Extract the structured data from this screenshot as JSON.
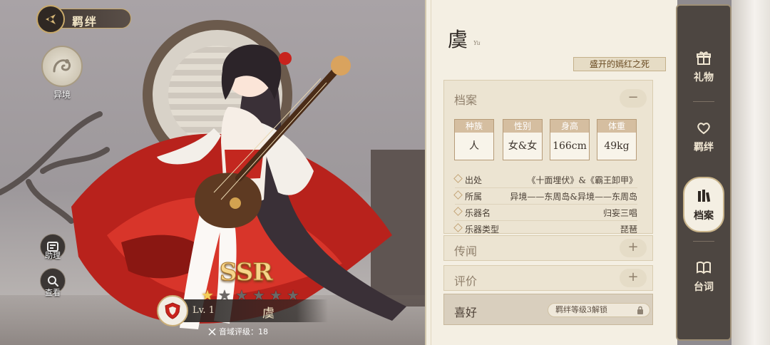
{
  "header": {
    "title": "羁绊"
  },
  "left_menu": {
    "world_label": "异境",
    "assist_label": "助理",
    "view_label": "查看"
  },
  "character": {
    "rarity": "SSR",
    "stars_total": 6,
    "stars_filled": 1,
    "level": "Lv. 1",
    "name": "虞",
    "rank": "音域评级：18"
  },
  "profile": {
    "name": "虞",
    "name_romaji": "Yu",
    "epithet": "盛开的嫣红之死",
    "section_archive": "档案",
    "attributes": [
      {
        "label": "种族",
        "value": "人"
      },
      {
        "label": "性别",
        "value": "女&女"
      },
      {
        "label": "身高",
        "value": "166cm"
      },
      {
        "label": "体重",
        "value": "49kg"
      }
    ],
    "info": [
      {
        "key": "出处",
        "value": "《十面埋伏》&《霸王卸甲》"
      },
      {
        "key": "所属",
        "value": "异境——东周岛&异境——东周岛"
      },
      {
        "key": "乐器名",
        "value": "归妄三唱"
      },
      {
        "key": "乐器类型",
        "value": "琵琶"
      }
    ],
    "section_rumor": "传闻",
    "section_review": "评价",
    "section_favorite": "喜好",
    "favorite_lock": "羁绊等级3解锁",
    "toggle_minus": "−",
    "toggle_plus": "+"
  },
  "tabs": [
    {
      "label": "礼物",
      "icon": "gift-icon",
      "active": false
    },
    {
      "label": "羁绊",
      "icon": "heart-link-icon",
      "active": false
    },
    {
      "label": "档案",
      "icon": "books-icon",
      "active": true
    },
    {
      "label": "台词",
      "icon": "open-book-icon",
      "active": false
    }
  ],
  "colors": {
    "accent_gold": "#c8a96a",
    "panel_bg": "#f4efe3",
    "tab_column": "#4d4641",
    "rarity_gold": "#f6d58a"
  }
}
